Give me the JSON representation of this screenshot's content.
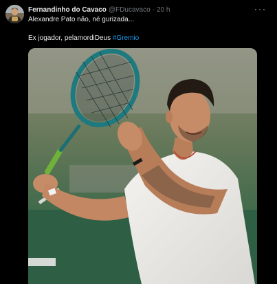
{
  "tweet": {
    "author_name": "Fernandinho do Cavaco",
    "author_handle": "@FDucavaco",
    "separator": "·",
    "time": "20 h",
    "text_line1": "Alexandre Pato não, né gurizada...",
    "text_line2_prefix": "Ex jogador, pelamordiDeus ",
    "hashtag": "#Gremio",
    "avatar_icon": "person-avatar-icon",
    "more_icon": "more-options-icon",
    "hashtag_color": "#1d9bf0",
    "muted_color": "#71767b"
  },
  "media": {
    "description_icon": "photo-tennis-player"
  }
}
